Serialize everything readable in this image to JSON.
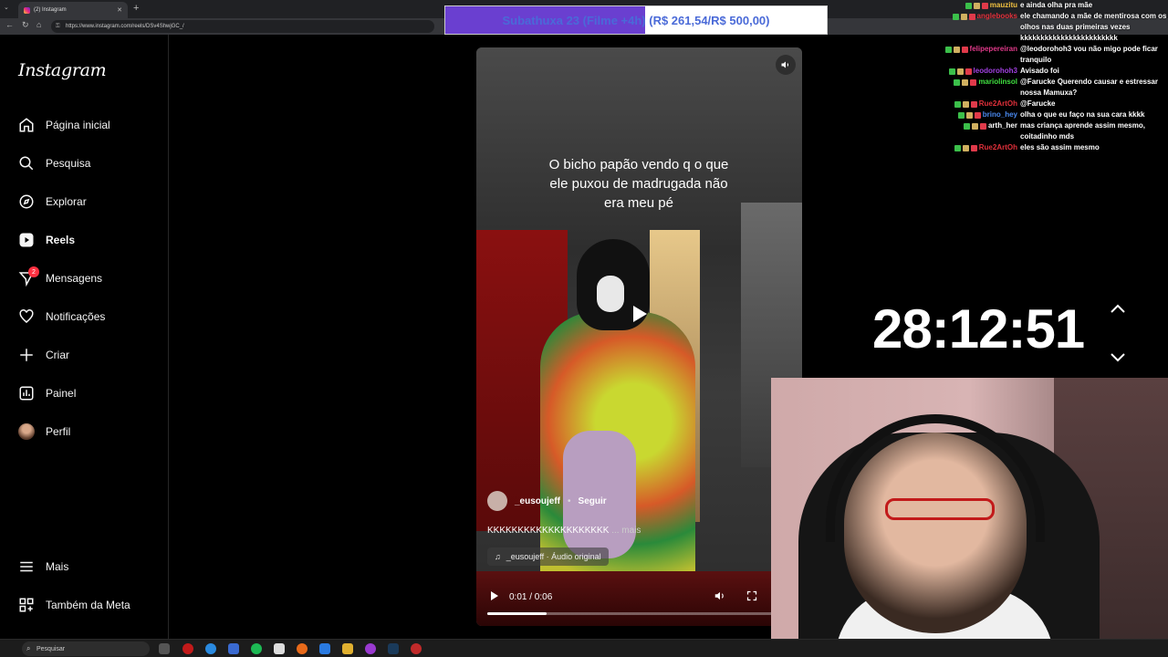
{
  "browser": {
    "tab_title": "(2) Instagram",
    "url": "https://www.instagram.com/reels/DSv4ShwjGC_/"
  },
  "donation": {
    "text": "Subathuxa 23 (Filme +4h) (R$ 261,54/R$ 500,00)",
    "progress_fraction": 0.523
  },
  "sidebar": {
    "logo": "Instagram",
    "items": [
      {
        "label": "Página inicial",
        "icon": "home-icon"
      },
      {
        "label": "Pesquisa",
        "icon": "search-icon"
      },
      {
        "label": "Explorar",
        "icon": "compass-icon"
      },
      {
        "label": "Reels",
        "icon": "reels-icon"
      },
      {
        "label": "Mensagens",
        "icon": "messenger-icon",
        "badge": "2"
      },
      {
        "label": "Notificações",
        "icon": "heart-icon"
      },
      {
        "label": "Criar",
        "icon": "plus-icon"
      },
      {
        "label": "Painel",
        "icon": "dashboard-icon"
      },
      {
        "label": "Perfil",
        "icon": "avatar"
      }
    ],
    "more_label": "Mais",
    "meta_label": "Também da Meta"
  },
  "reel": {
    "caption": "O bicho papão vendo q o que ele puxou de madrugada não era meu pé",
    "username": "_eusoujeff",
    "follow_label": "Seguir",
    "description": "KKKKKKKKKKKKKKKKKKKK",
    "more_label": "... mais",
    "audio": "_eusoujeff · Áudio original",
    "time": "0:01 / 0:06",
    "progress_fraction": 0.2
  },
  "timer": "28:12:51",
  "chat": [
    {
      "user": "mauzitu",
      "color": "#f0c040",
      "msg": "e ainda olha pra mãe"
    },
    {
      "user": "anglebooks",
      "color": "#e0303a",
      "msg": "ele chamando a mãe de mentirosa com os"
    },
    {
      "user": "",
      "color": "#fff",
      "msg": "olhos nas duas primeiras vezes"
    },
    {
      "user": "",
      "color": "#fff",
      "msg": "kkkkkkkkkkkkkkkkkkkkkkkk"
    },
    {
      "user": "felipepereiran",
      "color": "#e03a8a",
      "msg": "@leodorohoh3 vou não migo pode ficar"
    },
    {
      "user": "",
      "color": "#fff",
      "msg": "tranquilo"
    },
    {
      "user": "leodorohoh3",
      "color": "#a040e0",
      "msg": "Avisado foi"
    },
    {
      "user": "mariolinsol",
      "color": "#40e040",
      "msg": "@Farucke Querendo causar e estressar"
    },
    {
      "user": "",
      "color": "#fff",
      "msg": "nossa Mamuxa?"
    },
    {
      "user": "Rue2ArtOh",
      "color": "#e0303a",
      "msg": "@Farucke"
    },
    {
      "user": "brino_hey",
      "color": "#4a8af0",
      "msg": "olha o que eu faço na sua cara kkkk"
    },
    {
      "user": "arth_her",
      "color": "#ffffff",
      "msg": "mas criança aprende assim mesmo,"
    },
    {
      "user": "",
      "color": "#fff",
      "msg": "coitadinho mds"
    },
    {
      "user": "Rue2ArtOh",
      "color": "#e0303a",
      "msg": "eles são assim mesmo"
    }
  ],
  "taskbar": {
    "search_placeholder": "Pesquisar"
  }
}
